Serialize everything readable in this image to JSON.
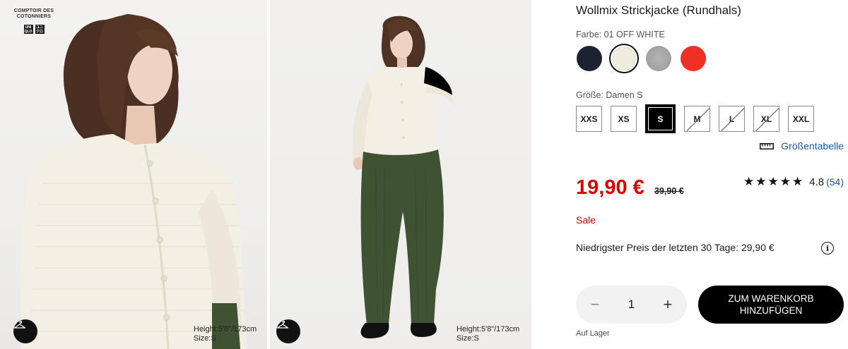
{
  "brand": {
    "collab_text": "COMPTOIR DES COTONNIERS",
    "logo_left": "UNI QLO",
    "logo_right": "ユニ クロ"
  },
  "photos": [
    {
      "model_height": "Height:5'8\"/173cm",
      "model_size": "Size:S"
    },
    {
      "model_height": "Height:5'8\"/173cm",
      "model_size": "Size:S"
    }
  ],
  "product": {
    "title": "Wollmix Strickjacke (Rundhals)",
    "color_label": "Farbe: 01 OFF WHITE",
    "swatches": [
      {
        "name": "navy",
        "color": "#1c2230"
      },
      {
        "name": "off white",
        "color": "#f1ece0",
        "selected": true
      },
      {
        "name": "grey",
        "color": "#a5a5a5"
      },
      {
        "name": "red",
        "color": "#ee3124"
      }
    ],
    "size_label": "Größe: Damen S",
    "sizes": [
      {
        "label": "XXS",
        "state": "available"
      },
      {
        "label": "XS",
        "state": "available"
      },
      {
        "label": "S",
        "state": "selected"
      },
      {
        "label": "M",
        "state": "unavailable"
      },
      {
        "label": "L",
        "state": "unavailable"
      },
      {
        "label": "XL",
        "state": "unavailable"
      },
      {
        "label": "XXL",
        "state": "available"
      }
    ],
    "size_chart_label": "Größentabelle",
    "price": "19,90 €",
    "old_price": "39,90 €",
    "rating_stars": "★★★★★",
    "rating_value": "4.8",
    "rating_count": "(54)",
    "sale_label": "Sale",
    "lowest_price_text": "Niedrigster Preis der letzten 30 Tage: 29,90 €",
    "quantity": "1",
    "add_to_cart_label": "ZUM WARENKORB HINZUFÜGEN",
    "stock_label": "Auf Lager"
  },
  "colors": {
    "sale_red": "#dd0000",
    "link_blue": "#1a5ca8",
    "cardigan": "#f3efe4",
    "trousers": "#3f5231"
  }
}
